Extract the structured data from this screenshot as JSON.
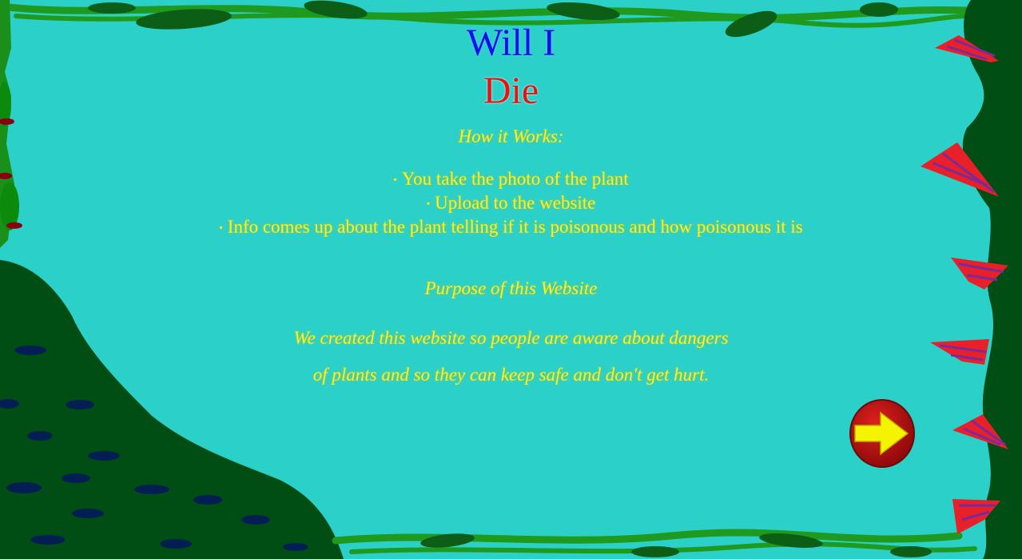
{
  "title": {
    "line1": "Will I",
    "line2": "Die"
  },
  "how_it_works": {
    "heading": "How it Works:",
    "steps": [
      "You take the photo of the plant",
      "Upload to the website",
      "Info comes up about the plant telling if it is poisonous and how poisonous it is"
    ]
  },
  "purpose": {
    "heading": "Purpose of this Website",
    "line1": "We created this website so people are aware about dangers",
    "line2": "of plants and so they can keep safe and don't get hurt."
  },
  "next_button": {
    "icon": "right-arrow-icon"
  },
  "colors": {
    "background": "#2bd1c8",
    "title_blue": "#1010ee",
    "title_red": "#ee1010",
    "text_yellow": "#f4f032",
    "foliage_dark": "#004e14",
    "vine_green": "#1a9a1a"
  }
}
